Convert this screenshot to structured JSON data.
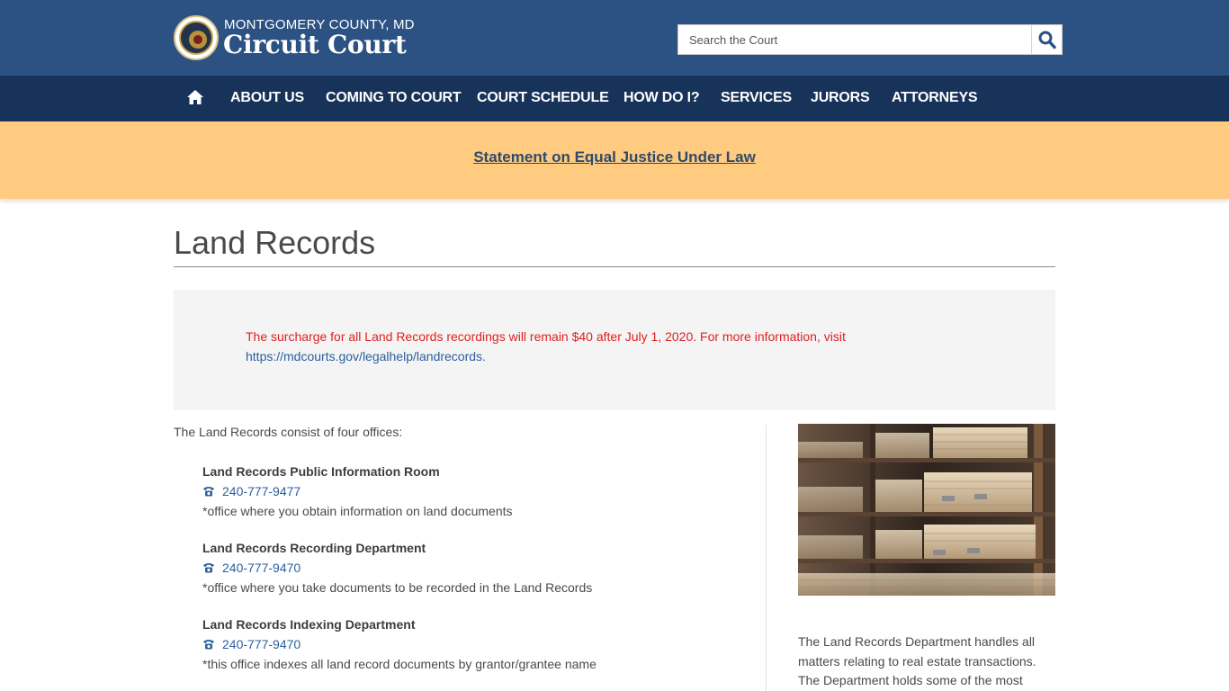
{
  "header": {
    "county": "MONTGOMERY COUNTY, MD",
    "title": "Circuit Court",
    "search_placeholder": "Search the Court",
    "brand_color": "#2b5283",
    "nav_color": "#18335a"
  },
  "nav": {
    "home_icon": "home-icon",
    "items": [
      "ABOUT US",
      "COMING TO COURT",
      "COURT SCHEDULE",
      "HOW DO I?",
      "SERVICES",
      "JURORS",
      "ATTORNEYS"
    ]
  },
  "banner": {
    "link_text": "Statement on Equal Justice Under Law",
    "color": "#ffcb80"
  },
  "page": {
    "title": "Land Records"
  },
  "notice": {
    "text": "The surcharge for all Land Records recordings will remain $40 after July 1, 2020. For more information, visit",
    "link": "https://mdcourts.gov/legalhelp/landrecords",
    "trailing": ".",
    "text_color": "#e02020"
  },
  "main": {
    "intro": "The Land Records consist of four offices:",
    "offices": [
      {
        "name": "Land Records Public Information Room",
        "phone": "240-777-9477",
        "description": "*office where you obtain information on land documents"
      },
      {
        "name": "Land Records Recording Department",
        "phone": "240-777-9470",
        "description": "*office where you take documents to be recorded in the Land Records"
      },
      {
        "name": "Land Records Indexing Department",
        "phone": "240-777-9470",
        "description": "*this office indexes all land record documents by grantor/grantee name"
      }
    ]
  },
  "sidebar": {
    "text": "The Land Records Department handles all matters relating to real estate transactions. The Department holds some of the most"
  }
}
